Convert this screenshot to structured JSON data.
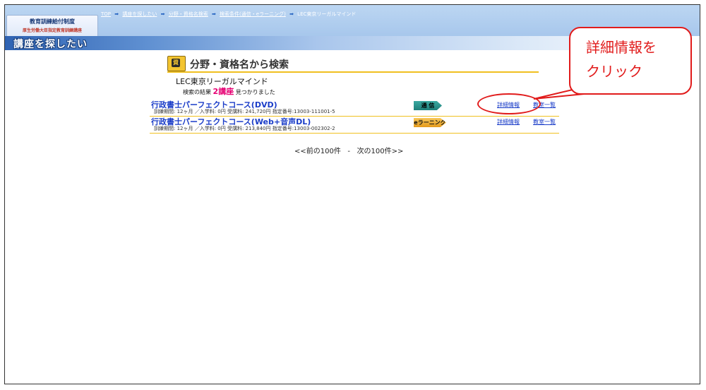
{
  "header": {
    "logo_line1": "教育訓練給付制度",
    "logo_line2": "厚生労働大臣指定教育訓練講座",
    "breadcrumbs": [
      "TOP",
      "講座を探したい",
      "分野・資格名検索",
      "検索条件(通信・eラーニング)",
      "LEC東京リーガルマインド"
    ],
    "page_title": "講座を探したい"
  },
  "search": {
    "heading": "分野・資格名から検索",
    "school": "LEC東京リーガルマインド",
    "result_prefix": "検索の結果",
    "result_count": "2講座",
    "result_suffix": "見つかりました"
  },
  "courses": [
    {
      "title": "行政書士パーフェクトコース(DVD)",
      "info": "訓練期間: 12ヶ月 ／入学料: 0円  受講料: 241,720円  指定番号:13003-111001-5",
      "badge": "通 信",
      "detail_link": "詳細情報",
      "class_link": "教室一覧"
    },
    {
      "title": "行政書士パーフェクトコース(Web+音声DL)",
      "info": "訓練期間: 12ヶ月 ／入学料: 0円  受講料: 213,840円  指定番号:13003-002302-2",
      "badge": "eラーニング",
      "detail_link": "詳細情報",
      "class_link": "教室一覧"
    }
  ],
  "pager": {
    "prev": "<<前の100件",
    "separator": "-",
    "next": "次の100件>>"
  },
  "annotation": {
    "callout_text": "詳細情報を\nクリック",
    "color": "#e11b1b"
  }
}
